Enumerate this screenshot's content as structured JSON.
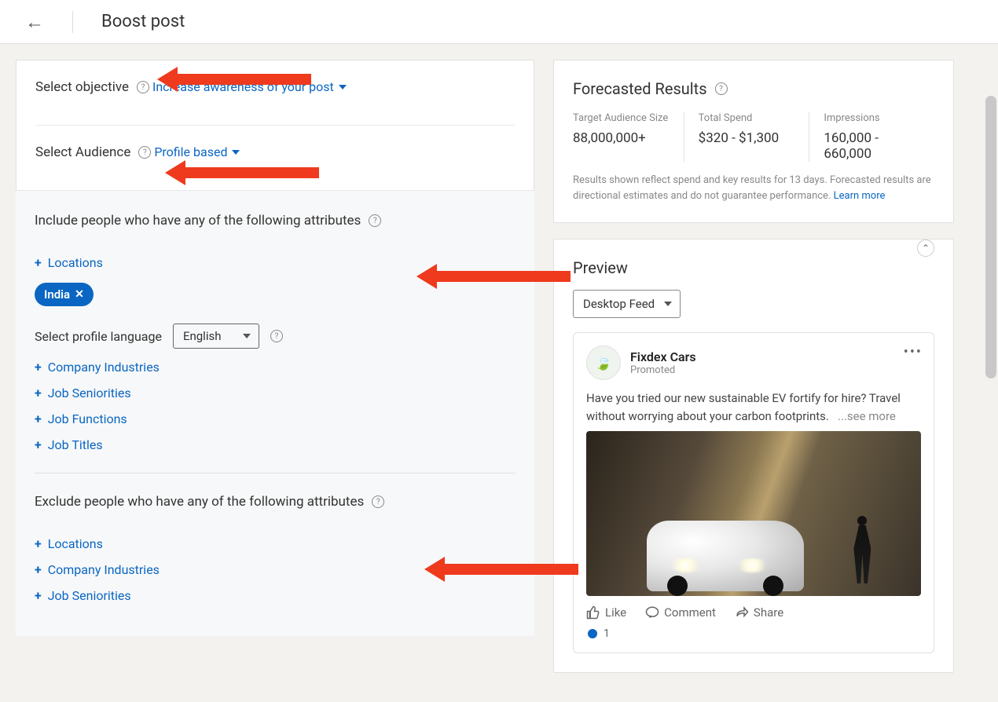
{
  "header": {
    "title": "Boost post"
  },
  "objective": {
    "title": "Select objective",
    "dropdown": "Increase awareness of your post"
  },
  "audience": {
    "title": "Select Audience",
    "dropdown": "Profile based"
  },
  "include": {
    "title": "Include people who have any of the following attributes",
    "locations_label": "Locations",
    "chip": "India",
    "profile_lang_label": "Select profile language",
    "lang_value": "English",
    "attrs": [
      "Company Industries",
      "Job Seniorities",
      "Job Functions",
      "Job Titles"
    ]
  },
  "exclude": {
    "title": "Exclude people who have any of the following attributes",
    "attrs": [
      "Locations",
      "Company Industries",
      "Job Seniorities"
    ]
  },
  "forecast": {
    "title": "Forecasted Results",
    "metrics": [
      {
        "label": "Target Audience Size",
        "value": "88,000,000+"
      },
      {
        "label": "Total Spend",
        "value": "$320 - $1,300"
      },
      {
        "label": "Impressions",
        "value": "160,000 - 660,000"
      }
    ],
    "disclaimer": "Results shown reflect spend and key results for 13 days. Forecasted results are directional estimates and do not guarantee performance.",
    "learn_more": "Learn more"
  },
  "preview": {
    "title": "Preview",
    "feed_type": "Desktop Feed",
    "post": {
      "name": "Fixdex Cars",
      "promoted": "Promoted",
      "body": "Have you tried our new sustainable EV fortify for hire? Travel without worrying about your carbon footprints.",
      "see_more": "...see more",
      "actions": {
        "like": "Like",
        "comment": "Comment",
        "share": "Share"
      },
      "reactions": "1"
    }
  }
}
